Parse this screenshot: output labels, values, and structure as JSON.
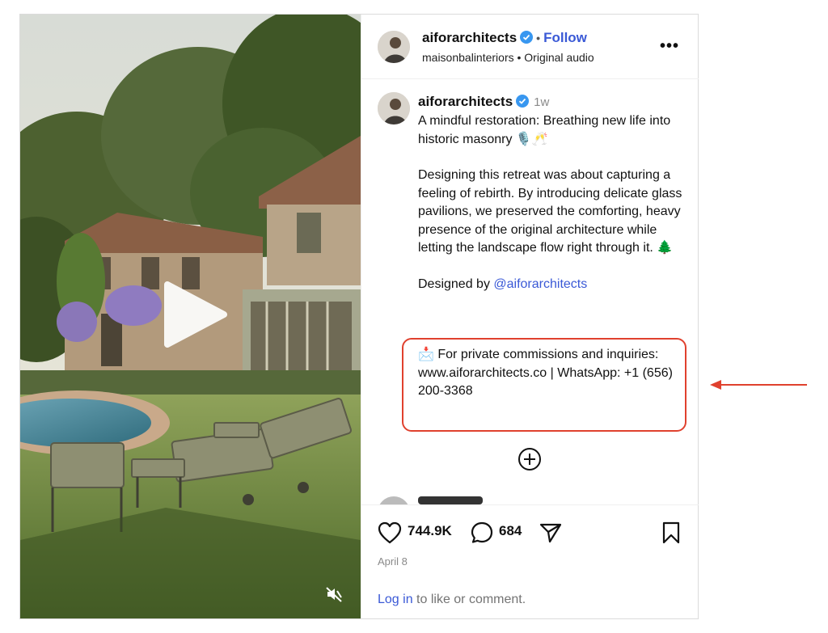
{
  "header": {
    "username": "aiforarchitects",
    "separator": "•",
    "follow_label": "Follow",
    "audio_line": "maisonbalinteriors • Original audio",
    "more_label": "•••"
  },
  "caption": {
    "username": "aiforarchitects",
    "time_ago": "1w",
    "lines": [
      "A mindful restoration: Breathing new life into historic masonry 🎙️🥂",
      "Designing this retreat was about capturing a feeling of rebirth. By introducing delicate glass pavilions, we preserved the comforting, heavy presence of the original architecture while letting the landscape flow right through it. 🌲"
    ],
    "designed_by_prefix": "Designed by ",
    "designed_by_mention": "@aiforarchitects",
    "commission_text": "📩 For private commissions and inquiries: www.aiforarchitects.co | WhatsApp: +1 (656) 200-3368"
  },
  "stats": {
    "likes": "744.9K",
    "comments": "684",
    "date": "April 8"
  },
  "footer": {
    "login_link": "Log in",
    "login_rest": " to like or comment."
  },
  "icons": {
    "verified": "verified-badge-icon",
    "play": "play-icon",
    "mute": "muted-speaker-icon",
    "plus": "add-circle-icon",
    "like": "heart-icon",
    "comment": "comment-bubble-icon",
    "share": "share-paper-plane-icon",
    "save": "bookmark-icon"
  },
  "colors": {
    "link_blue": "#3a59d6",
    "verified_blue": "#3897f0",
    "highlight_red": "#e0412e",
    "muted_gray": "#8a8a8a"
  }
}
